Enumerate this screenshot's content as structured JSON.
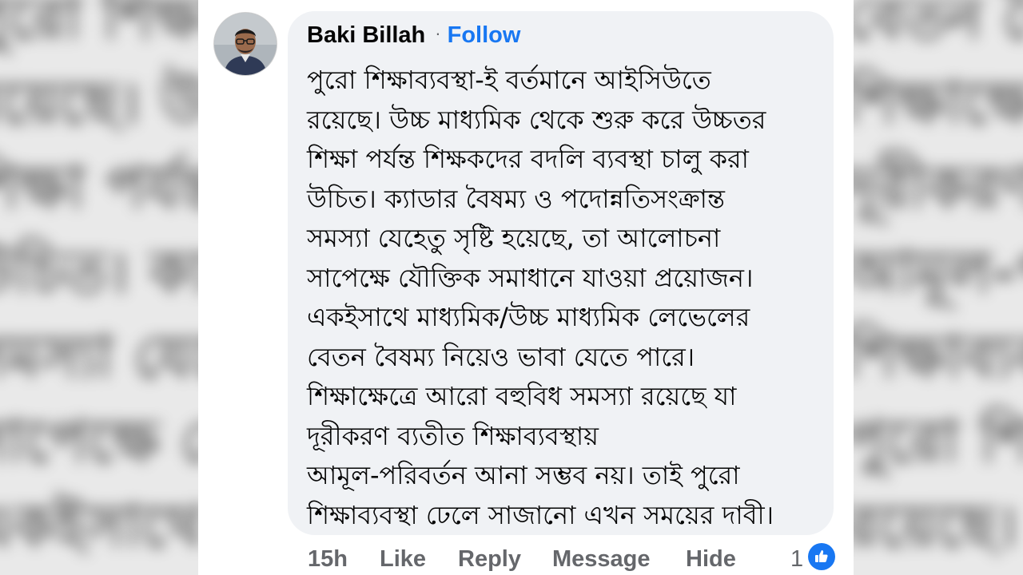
{
  "comment": {
    "author": "Baki Billah",
    "separator": "·",
    "follow_label": "Follow",
    "lines": [
      "পুরো শিক্ষাব্যবস্থা-ই বর্তমানে আইসিউতে",
      "রয়েছে। উচ্চ মাধ্যমিক থেকে শুরু করে উচ্চতর",
      "শিক্ষা পর্যন্ত শিক্ষকদের বদলি ব্যবস্থা চালু করা",
      "উচিত। ক্যাডার বৈষম্য ও পদোন্নতিসংক্রান্ত",
      "সমস্যা যেহেতু সৃষ্টি হয়েছে, তা আলোচনা",
      "সাপেক্ষে যৌক্তিক সমাধানে যাওয়া প্রয়োজন।",
      "একইসাথে মাধ্যমিক/উচ্চ মাধ্যমিক লেভেলের",
      "বেতন বৈষম্য নিয়েও ভাবা যেতে পারে।",
      "শিক্ষাক্ষেত্রে আরো বহুবিধ সমস্যা রয়েছে যা",
      "দূরীকরণ ব্যতীত শিক্ষাব্যবস্থায়",
      "আমূল-পরিবর্তন আনা সম্ভব নয়। তাই পুরো",
      "শিক্ষাব্যবস্থা ঢেলে সাজানো এখন সময়ের দাবী।"
    ]
  },
  "actions": {
    "time": "15h",
    "like": "Like",
    "reply": "Reply",
    "message": "Message",
    "hide": "Hide",
    "reaction_count": "1"
  },
  "colors": {
    "accent": "#1877f2",
    "bubble": "#f0f2f5",
    "muted": "#65676b"
  },
  "icons": {
    "reaction": "thumbs-up-icon",
    "avatar": "profile-photo"
  }
}
